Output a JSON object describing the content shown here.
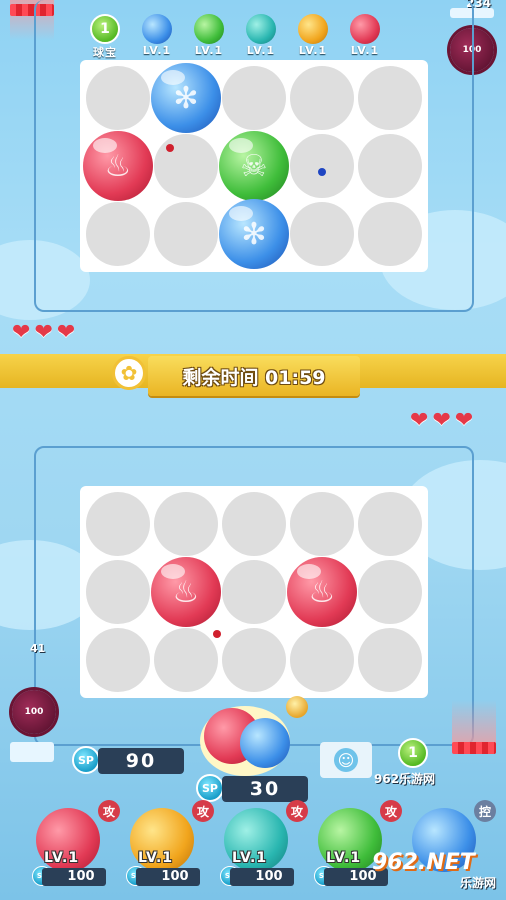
{
  "top": {
    "gem_label": "球宝",
    "gem_badge": "1",
    "gem_levels": [
      "LV.1",
      "LV.1",
      "LV.1",
      "LV.1",
      "LV.1"
    ],
    "corner_score": "234",
    "enemy_hp": "100"
  },
  "timer": {
    "label": "剩余时间 01:59"
  },
  "bottom": {
    "side_value": "41",
    "my_hp": "100",
    "sp_total": "90",
    "sp_cost": "30",
    "rank_badge": "1",
    "watermark_site": "962乐游网",
    "watermark_logo": "962.NET",
    "watermark_sub": "乐游网"
  },
  "cards": [
    {
      "tag": "攻",
      "level": "LV.1",
      "cost": "100",
      "type": "fire"
    },
    {
      "tag": "攻",
      "level": "LV.1",
      "cost": "100",
      "type": "yellow"
    },
    {
      "tag": "攻",
      "level": "LV.1",
      "cost": "100",
      "type": "teal"
    },
    {
      "tag": "攻",
      "level": "LV.1",
      "cost": "100",
      "type": "poison"
    },
    {
      "tag": "控",
      "level": "LV.1",
      "cost": "100",
      "type": "ice"
    }
  ],
  "sp_label": "SP",
  "colors": {
    "fire": "#e23a55",
    "ice": "#3c8fe8",
    "poison": "#3fbd3a",
    "yellow": "#f1a51d",
    "teal": "#29b6b0",
    "banner": "#f1c136"
  }
}
